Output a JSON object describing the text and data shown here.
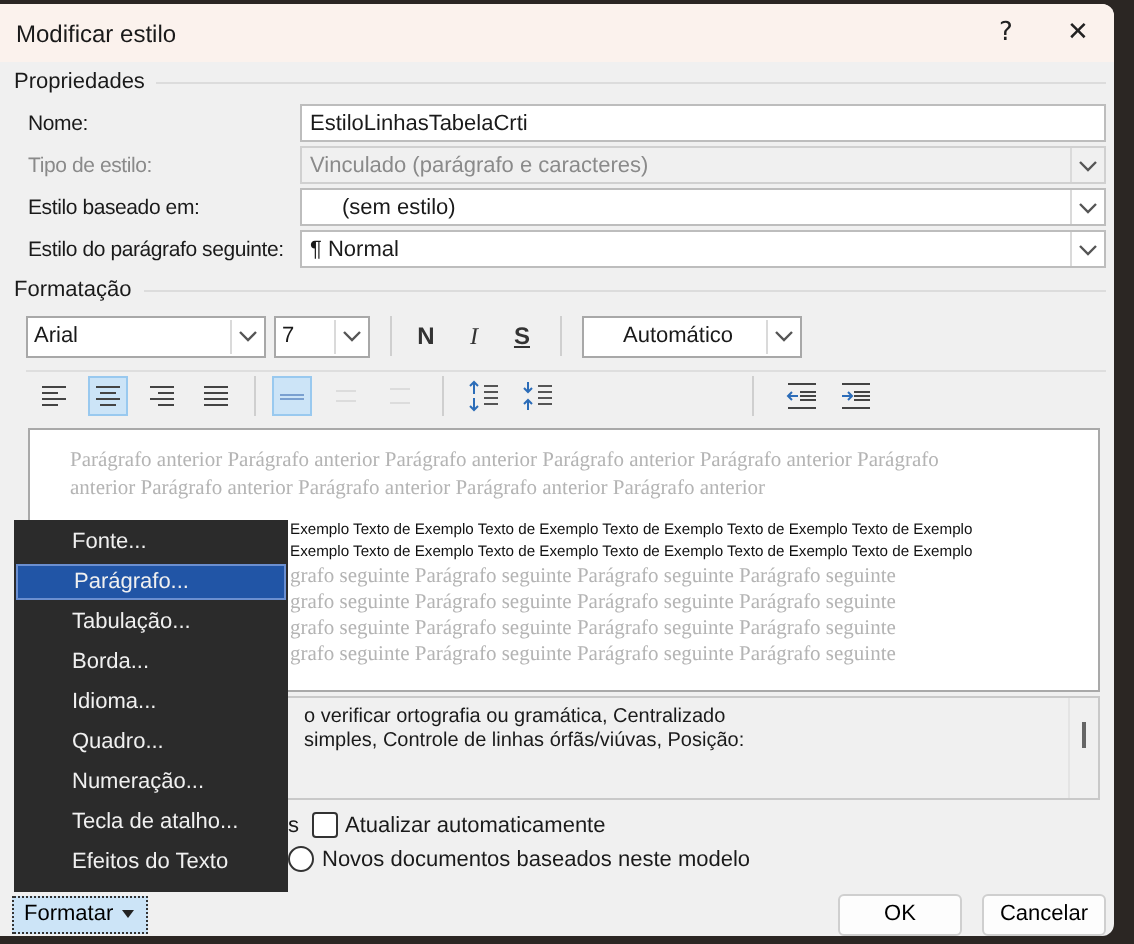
{
  "window": {
    "title": "Modificar estilo",
    "help_button": "?",
    "close_button": "✕"
  },
  "properties": {
    "heading": "Propriedades",
    "fields": [
      {
        "label": "Nome:",
        "value": "EstiloLinhasTabelaCrti",
        "kind": "text",
        "disabled": false
      },
      {
        "label": "Tipo de estilo:",
        "value": "Vinculado (parágrafo e caracteres)",
        "kind": "dropdown",
        "disabled": true
      },
      {
        "label": "Estilo baseado em:",
        "value": "(sem estilo)",
        "kind": "dropdown",
        "disabled": false
      },
      {
        "label": "Estilo do parágrafo seguinte:",
        "value": "¶ Normal",
        "kind": "dropdown",
        "disabled": false
      }
    ]
  },
  "formatting": {
    "heading": "Formatação",
    "font": "Arial",
    "size": "7",
    "color_label": "Automático",
    "style_buttons": [
      {
        "label": "N",
        "kind": "bold"
      },
      {
        "label": "I",
        "kind": "italic"
      },
      {
        "label": "S",
        "kind": "underline"
      }
    ],
    "paragraph_tools": [
      {
        "kind": "align-left",
        "selected": false
      },
      {
        "kind": "align-center",
        "selected": true
      },
      {
        "kind": "align-right",
        "selected": false
      },
      {
        "kind": "justify",
        "selected": false
      },
      {
        "kind": "single-spacing",
        "selected": true
      },
      {
        "kind": "one-half-spacing",
        "selected": false
      },
      {
        "kind": "double-spacing",
        "selected": false
      },
      {
        "kind": "space-before",
        "selected": false
      },
      {
        "kind": "space-after",
        "selected": false
      },
      {
        "kind": "indent-decrease",
        "selected": false
      },
      {
        "kind": "indent-increase",
        "selected": false
      }
    ]
  },
  "preview": {
    "previous_lines": [
      "Parágrafo anterior Parágrafo anterior Parágrafo anterior Parágrafo anterior Parágrafo anterior Parágrafo",
      "anterior Parágrafo anterior Parágrafo anterior Parágrafo anterior Parágrafo anterior"
    ],
    "sample_lines": [
      "Exemplo Texto de Exemplo Texto de Exemplo Texto de Exemplo Texto de Exemplo Texto de Exemplo",
      "Exemplo Texto de Exemplo Texto de Exemplo Texto de Exemplo Texto de Exemplo Texto de Exemplo"
    ],
    "following_lines": [
      "grafo seguinte Parágrafo seguinte Parágrafo seguinte Parágrafo seguinte",
      "grafo seguinte Parágrafo seguinte Parágrafo seguinte Parágrafo seguinte",
      "grafo seguinte Parágrafo seguinte Parágrafo seguinte Parágrafo seguinte",
      "grafo seguinte Parágrafo seguinte Parágrafo seguinte Parágrafo seguinte"
    ]
  },
  "description": [
    "o verificar ortografia ou gramática, Centralizado",
    "simples, Controle de linhas órfãs/viúvas, Posição:"
  ],
  "options": {
    "partial_text": "s",
    "auto_update": {
      "label": "Atualizar automaticamente",
      "checked": false
    },
    "template": {
      "label": "Novos documentos baseados neste modelo",
      "selected": false
    }
  },
  "format_menu": {
    "button": "Formatar",
    "items": [
      {
        "label": "Fonte...",
        "selected": false
      },
      {
        "label": "Parágrafo...",
        "selected": true
      },
      {
        "label": "Tabulação...",
        "selected": false
      },
      {
        "label": "Borda...",
        "selected": false
      },
      {
        "label": "Idioma...",
        "selected": false
      },
      {
        "label": "Quadro...",
        "selected": false
      },
      {
        "label": "Numeração...",
        "selected": false
      },
      {
        "label": "Tecla de atalho...",
        "selected": false
      },
      {
        "label": "Efeitos do Texto",
        "selected": false
      }
    ]
  },
  "buttons": {
    "ok": "OK",
    "cancel": "Cancelar"
  }
}
